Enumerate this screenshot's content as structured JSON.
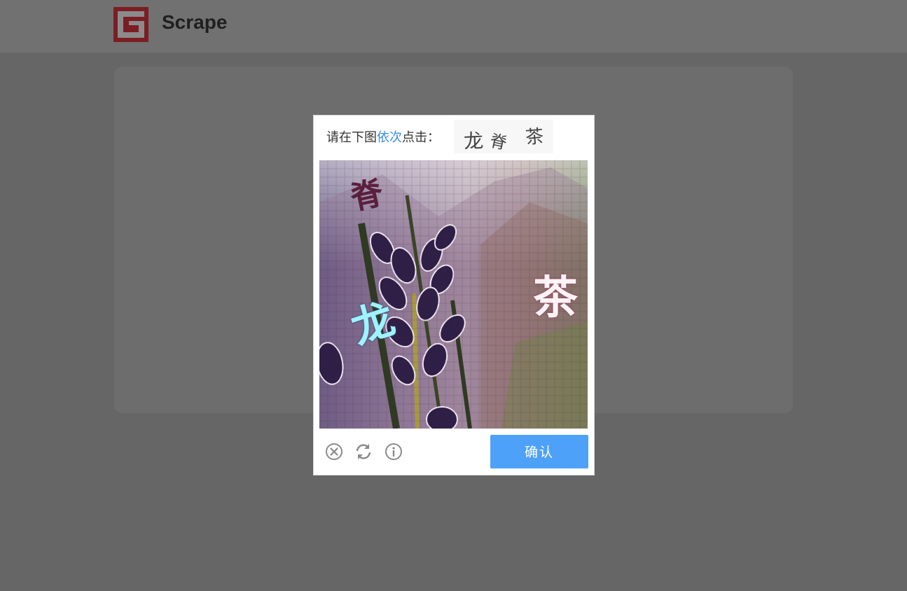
{
  "header": {
    "brand_name": "Scrape",
    "logo_icon": "scrape-logo",
    "logo_color": "#7c1d24"
  },
  "captcha": {
    "instruction_prefix": "请在下图",
    "instruction_highlight": "依次",
    "instruction_suffix": "点击：",
    "highlight_color": "#3a8ee6",
    "target_chars": [
      "龙",
      "脊",
      "茶"
    ],
    "image_chars": [
      "脊",
      "茶",
      "龙"
    ],
    "footer": {
      "close_icon": "close-icon",
      "refresh_icon": "refresh-icon",
      "info_icon": "info-icon",
      "confirm_label": "确认",
      "confirm_color": "#4ea1f9"
    }
  }
}
